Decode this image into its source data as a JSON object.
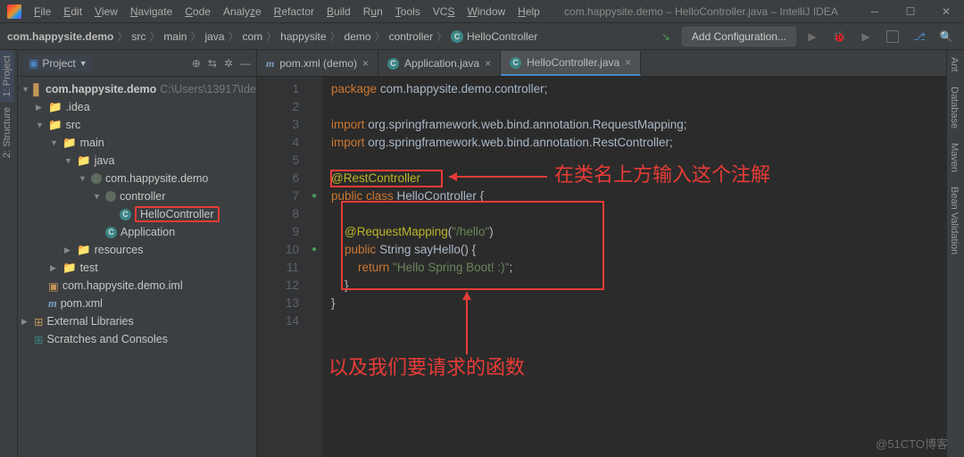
{
  "title": "com.happysite.demo – HelloController.java – IntelliJ IDEA",
  "menu": [
    "File",
    "Edit",
    "View",
    "Navigate",
    "Code",
    "Analyze",
    "Refactor",
    "Build",
    "Run",
    "Tools",
    "VCS",
    "Window",
    "Help"
  ],
  "breadcrumb": [
    "com.happysite.demo",
    "src",
    "main",
    "java",
    "com",
    "happysite",
    "demo",
    "controller",
    "HelloController"
  ],
  "addConfig": "Add Configuration...",
  "leftTabs": [
    "1: Project",
    "2: Structure"
  ],
  "rightTabs": [
    "Ant",
    "Database",
    "Maven",
    "Bean Validation"
  ],
  "sidebar": {
    "title": "Project",
    "root": "com.happysite.demo",
    "rootPath": "C:\\Users\\13917\\Ide",
    "idea": ".idea",
    "src": "src",
    "main": "main",
    "java": "java",
    "pkg": "com.happysite.demo",
    "ctrl": "controller",
    "hello": "HelloController",
    "app": "Application",
    "resources": "resources",
    "test": "test",
    "iml": "com.happysite.demo.iml",
    "pom": "pom.xml",
    "ext": "External Libraries",
    "scratch": "Scratches and Consoles"
  },
  "tabs": [
    {
      "label": "pom.xml (demo)",
      "icon": "m"
    },
    {
      "label": "Application.java",
      "icon": "c"
    },
    {
      "label": "HelloController.java",
      "icon": "c",
      "active": true
    }
  ],
  "code": {
    "lines": [
      {
        "n": 1,
        "html": "<span class='kw'>package</span> <span class='pkgc'>com.happysite.demo.controller;</span>"
      },
      {
        "n": 2,
        "html": ""
      },
      {
        "n": 3,
        "html": "<span class='kw'>import</span> <span class='pkgc'>org.springframework.web.bind.annotation.</span><span class='pkgc'>RequestMapping</span>;"
      },
      {
        "n": 4,
        "html": "<span class='kw'>import</span> <span class='pkgc'>org.springframework.web.bind.annotation.</span><span class='pkgc'>RestController</span>;"
      },
      {
        "n": 5,
        "html": ""
      },
      {
        "n": 6,
        "html": "<span class='ann'>@RestController</span>"
      },
      {
        "n": 7,
        "html": "<span class='kw'>public class</span> <span class='pkgc'>HelloController</span> {"
      },
      {
        "n": 8,
        "html": ""
      },
      {
        "n": 9,
        "html": "    <span class='ann'>@RequestMapping</span>(<span class='str'>\"/hello\"</span>)"
      },
      {
        "n": 10,
        "html": "    <span class='kw'>public</span> <span class='pkgc'>String</span> <span class='pkgc'>sayHello</span>() {"
      },
      {
        "n": 11,
        "html": "        <span class='kw'>return</span> <span class='str'>\"Hello Spring Boot! :)\"</span>;"
      },
      {
        "n": 12,
        "html": "    }"
      },
      {
        "n": 13,
        "html": "}"
      },
      {
        "n": 14,
        "html": ""
      }
    ]
  },
  "annotations": {
    "text1": "在类名上方输入这个注解",
    "text2": "以及我们要请求的函数"
  },
  "watermark": "@51CTO博客"
}
